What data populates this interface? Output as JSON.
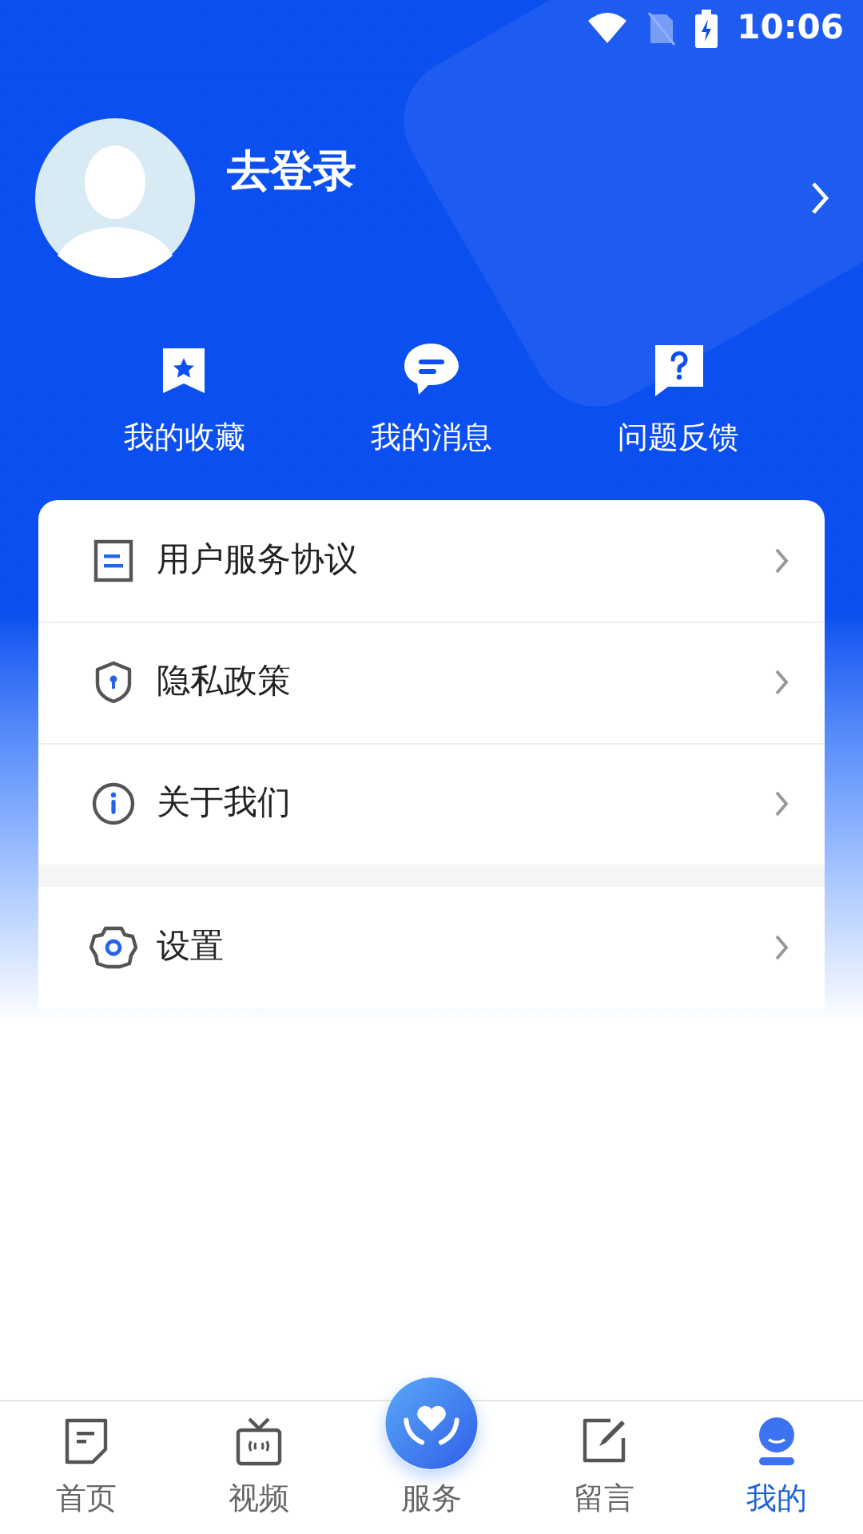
{
  "status_bar": {
    "time": "10:06"
  },
  "profile": {
    "login": "去登录"
  },
  "quick_actions": [
    {
      "label": "我的收藏"
    },
    {
      "label": "我的消息"
    },
    {
      "label": "问题反馈"
    }
  ],
  "menu_groups": [
    [
      {
        "label": "用户服务协议"
      },
      {
        "label": "隐私政策"
      },
      {
        "label": "关于我们"
      }
    ],
    [
      {
        "label": "设置"
      }
    ]
  ],
  "tab_bar": [
    {
      "label": "首页",
      "kind": "normal",
      "selected": false
    },
    {
      "label": "视频",
      "kind": "normal",
      "selected": false
    },
    {
      "label": "服务",
      "kind": "raised",
      "selected": false
    },
    {
      "label": "留言",
      "kind": "normal",
      "selected": false
    },
    {
      "label": "我的",
      "kind": "normal",
      "selected": true
    }
  ]
}
